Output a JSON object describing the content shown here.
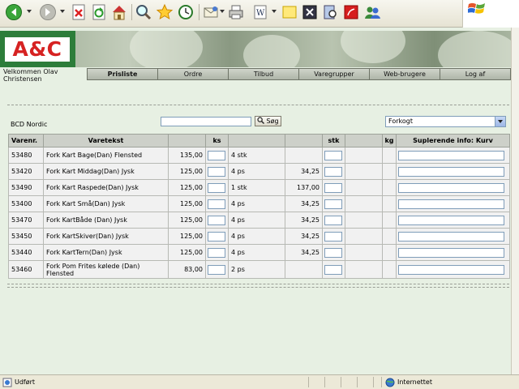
{
  "statusbar": {
    "status": "Udført",
    "zone": "Internettet"
  },
  "header": {
    "logo_text": "A&C",
    "welcome": "Velkommen Olav Christensen"
  },
  "nav": [
    "Prisliste",
    "Ordre",
    "Tilbud",
    "Varegrupper",
    "Web-brugere",
    "Log af"
  ],
  "toolbar_icons": [
    "back-icon",
    "forward-icon",
    "stop-icon",
    "refresh-icon",
    "home-icon",
    "search-icon",
    "favorites-icon",
    "history-icon",
    "mail-icon",
    "print-icon",
    "edit-icon",
    "notes-icon",
    "messenger-icon",
    "research-icon",
    "pdf-icon",
    "users-icon"
  ],
  "filter": {
    "company": "BCD Nordic",
    "search_value": "",
    "search_button": "Søg",
    "category_selected": "Forkogt"
  },
  "colors": {
    "logo_green": "#2d7d3a",
    "logo_red": "#d62222",
    "page_bg": "#e7f0e3"
  },
  "table": {
    "headers": {
      "varenr": "Varenr.",
      "varetekst": "Varetekst",
      "ks": "ks",
      "stk": "stk",
      "kg": "kg",
      "info": "Suplerende info: Kurv"
    },
    "rows": [
      {
        "varenr": "53480",
        "tekst": "Fork Kart Bage(Dan) Flensted",
        "price": "135,00",
        "pack": "4 stk",
        "unit_price": ""
      },
      {
        "varenr": "53420",
        "tekst": "Fork Kart Middag(Dan) Jysk",
        "price": "125,00",
        "pack": "4 ps",
        "unit_price": "34,25"
      },
      {
        "varenr": "53490",
        "tekst": "Fork Kart Raspede(Dan) Jysk",
        "price": "125,00",
        "pack": "1 stk",
        "unit_price": "137,00"
      },
      {
        "varenr": "53400",
        "tekst": "Fork Kart Små(Dan) Jysk",
        "price": "125,00",
        "pack": "4 ps",
        "unit_price": "34,25"
      },
      {
        "varenr": "53470",
        "tekst": "Fork KartBåde (Dan) Jysk",
        "price": "125,00",
        "pack": "4 ps",
        "unit_price": "34,25"
      },
      {
        "varenr": "53450",
        "tekst": "Fork KartSkiver(Dan) Jysk",
        "price": "125,00",
        "pack": "4 ps",
        "unit_price": "34,25"
      },
      {
        "varenr": "53440",
        "tekst": "Fork KartTern(Dan) Jysk",
        "price": "125,00",
        "pack": "4 ps",
        "unit_price": "34,25"
      },
      {
        "varenr": "53460",
        "tekst": "Fork Pom Frites kølede (Dan) Flensted",
        "price": "83,00",
        "pack": "2 ps",
        "unit_price": ""
      }
    ]
  }
}
